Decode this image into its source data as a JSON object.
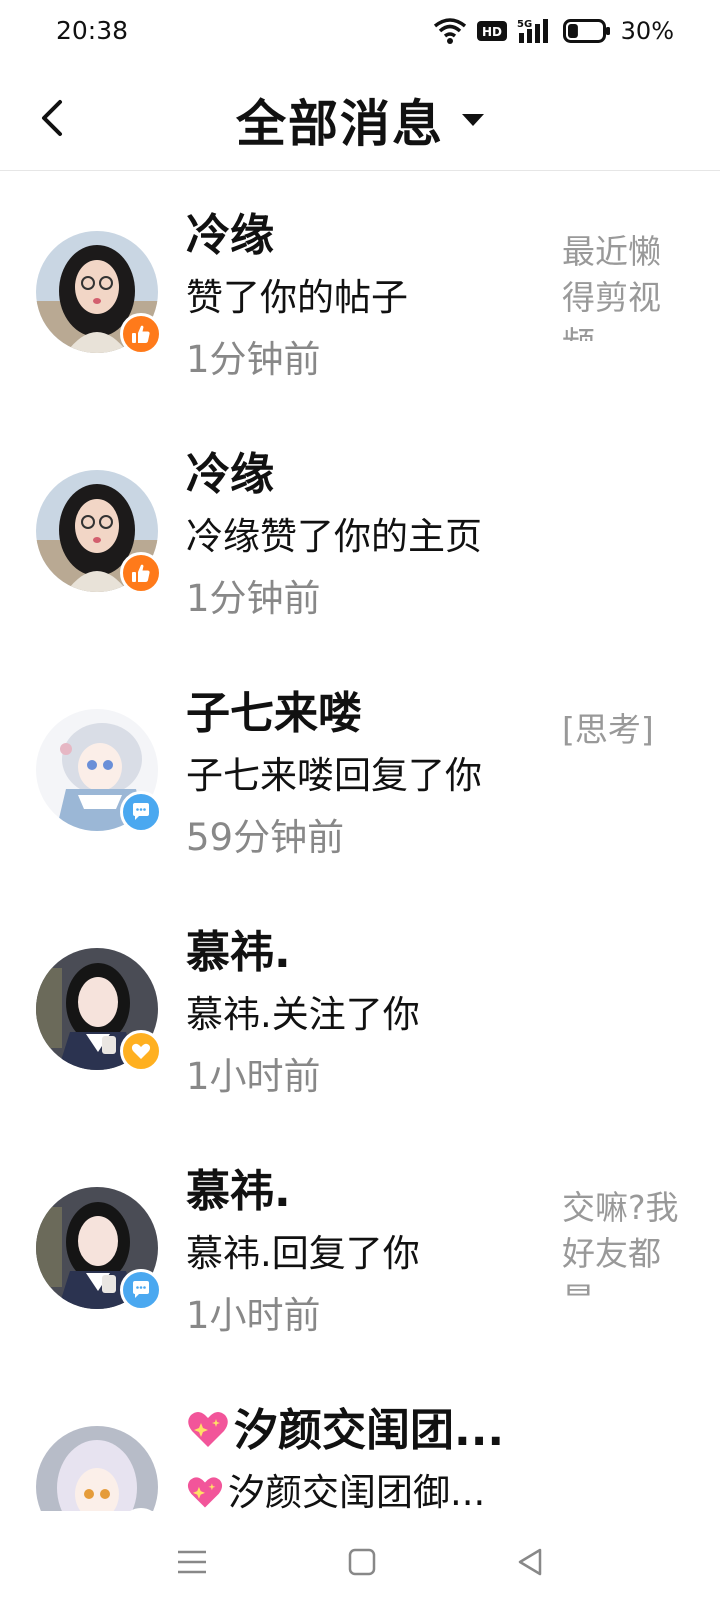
{
  "status_bar": {
    "time": "20:38",
    "battery": "30%",
    "battery_level": 0.3
  },
  "header": {
    "title": "全部消息"
  },
  "notifications": [
    {
      "name": "冷缘",
      "action": "赞了你的帖子",
      "time": "1分钟前",
      "preview": "最近懒得剪视频",
      "badge": "like",
      "badge_color": "#ff7a1a"
    },
    {
      "name": "冷缘",
      "action": "冷缘赞了你的主页",
      "time": "1分钟前",
      "preview": "",
      "badge": "like",
      "badge_color": "#ff7a1a"
    },
    {
      "name": "子七来喽",
      "action": "子七来喽回复了你",
      "time": "59分钟前",
      "preview": "[思考]",
      "badge": "comment",
      "badge_color": "#4aa8f0"
    },
    {
      "name": "慕祎.",
      "action": "慕祎.关注了你",
      "time": "1小时前",
      "preview": "",
      "badge": "follow",
      "badge_color": "#ffb020"
    },
    {
      "name": "慕祎.",
      "action": "慕祎.回复了你",
      "time": "1小时前",
      "preview": "交嘛?我好友都是",
      "badge": "comment",
      "badge_color": "#4aa8f0"
    },
    {
      "name": "汐颜交闺团...",
      "action": "汐颜交闺团御...",
      "time": "",
      "preview": "",
      "badge": "like",
      "badge_color": "#ff7a1a"
    }
  ],
  "icons": {
    "back": "chevron-left-icon",
    "dropdown": "caret-down-icon",
    "like": "thumbs-up-icon",
    "comment": "speech-bubble-icon",
    "follow": "heart-icon",
    "sparkle_heart": "sparkling-heart-emoji",
    "nav": [
      "menu-icon",
      "home-square-icon",
      "back-triangle-icon"
    ]
  }
}
